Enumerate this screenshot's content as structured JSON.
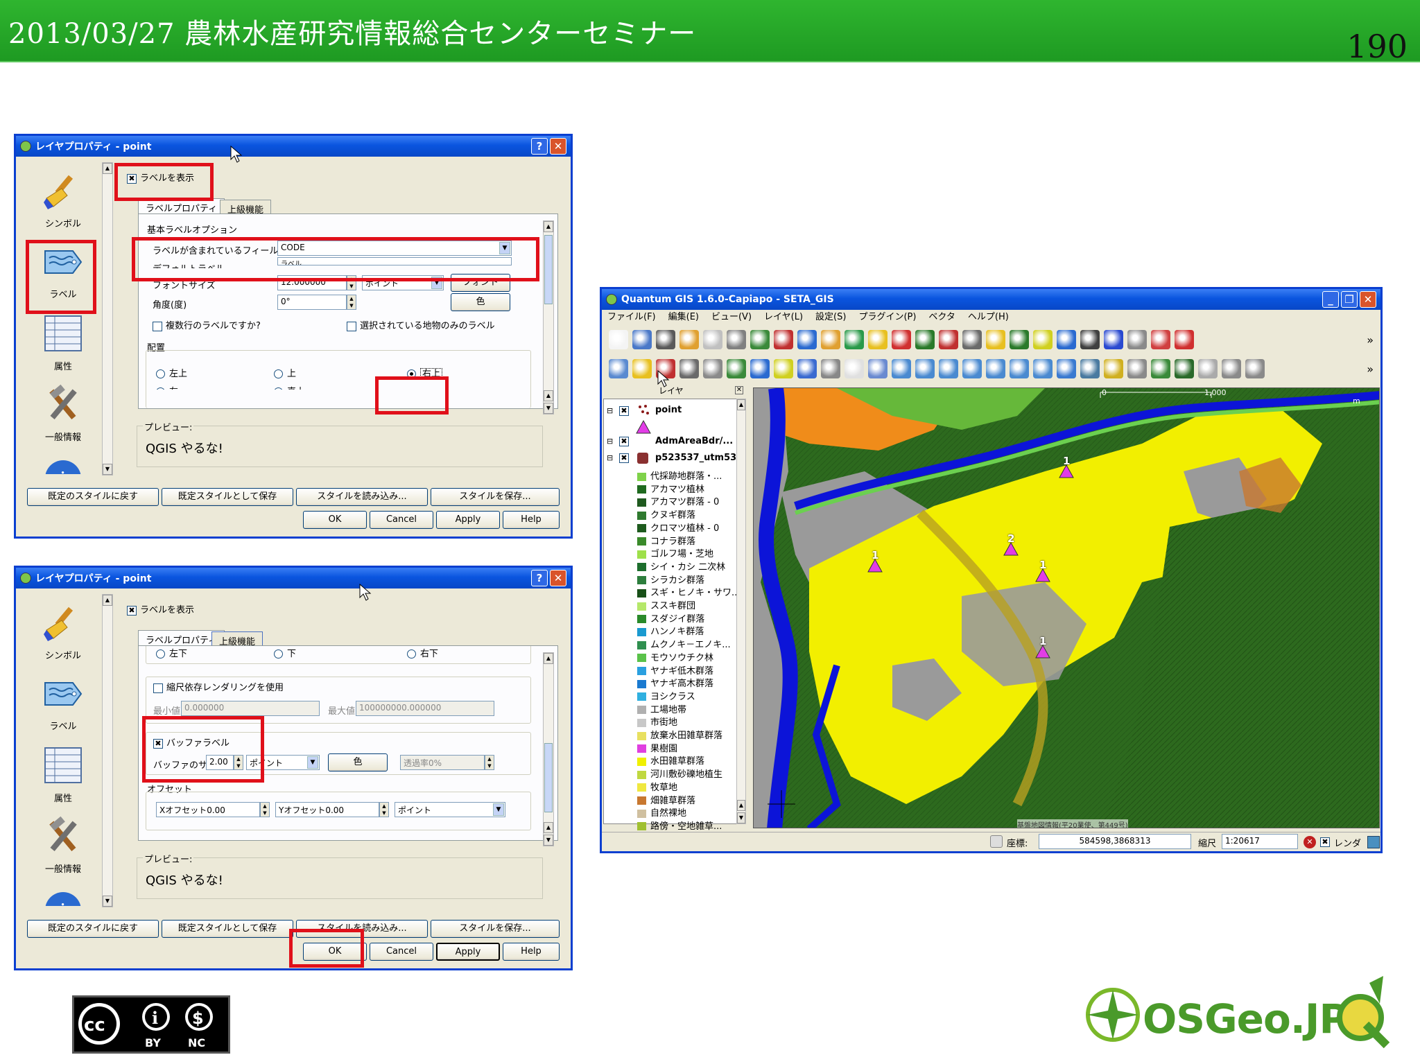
{
  "slide": {
    "title": "2013/03/27 農林水産研究情報総合センターセミナー",
    "page_number": "190",
    "license": {
      "by": "BY",
      "nc": "NC"
    },
    "logo_text": "OSGeo.JP"
  },
  "dialog1": {
    "title": "レイヤプロパティ - point",
    "sidebar": [
      "シンボル",
      "ラベル",
      "属性",
      "一般情報"
    ],
    "show_label": "ラベルを表示",
    "tabs": [
      "ラベルプロパティ",
      "上級機能"
    ],
    "basic_group": "基本ラベルオプション",
    "field_label": "ラベルが含まれているフィールド",
    "field_value": "CODE",
    "default_label": "デフォルトラベル",
    "default_label_value": "ラベル",
    "font_size_label": "フォントサイズ",
    "font_size_value": "12.000000",
    "unit": "ポイント",
    "font_button": "フォント",
    "angle_label": "角度(度)",
    "angle_value": "0°",
    "color_button": "色",
    "multiline": "複数行のラベルですか?",
    "selected_only": "選択されている地物のみのラベル",
    "placement_group": "配置",
    "placement": [
      "左上",
      "上",
      "右上"
    ],
    "placement_partial": [
      "左",
      "真上"
    ],
    "preview_title": "プレビュー:",
    "preview_text": "QGIS やるな!",
    "buttons_row1": [
      "既定のスタイルに戻す",
      "既定スタイルとして保存",
      "スタイルを読み込み...",
      "スタイルを保存..."
    ],
    "buttons_row2": [
      "OK",
      "Cancel",
      "Apply",
      "Help"
    ]
  },
  "dialog2": {
    "title": "レイヤプロパティ - point",
    "sidebar": [
      "シンボル",
      "ラベル",
      "属性",
      "一般情報"
    ],
    "show_label": "ラベルを表示",
    "tabs": [
      "ラベルプロパティ",
      "上級機能"
    ],
    "placement_bottom": [
      "左下",
      "下",
      "右下"
    ],
    "scale_render": "縮尺依存レンダリングを使用",
    "min_label": "最小値",
    "min_value": "0.000000",
    "max_label": "最大値",
    "max_value": "100000000.000000",
    "buffer_label": "バッファラベル",
    "buffer_size_label": "バッファのサイズ",
    "buffer_size_value": "2.00",
    "unit": "ポイント",
    "color_button": "色",
    "transparency": "透過率0%",
    "offset_group": "オフセット",
    "x_offset": "Xオフセット0.00",
    "y_offset": "Yオフセット0.00",
    "offset_unit": "ポイント",
    "preview_title": "プレビュー:",
    "preview_text": "QGIS やるな!",
    "buttons_row1": [
      "既定のスタイルに戻す",
      "既定スタイルとして保存",
      "スタイルを読み込み...",
      "スタイルを保存..."
    ],
    "buttons_row2": [
      "OK",
      "Cancel",
      "Apply",
      "Help"
    ]
  },
  "qgis": {
    "title": "Quantum GIS 1.6.0-Capiapo - SETA_GIS",
    "menu": [
      "ファイル(F)",
      "編集(E)",
      "ビュー(V)",
      "レイヤ(L)",
      "設定(S)",
      "プラグイン(P)",
      "ベクタ",
      "ヘルプ(H)"
    ],
    "legend_header": "レイヤ",
    "layers": [
      "point",
      "AdmAreaBdr/...",
      "p523537_utm53"
    ],
    "classes": [
      {
        "name": "代採跡地群落・...",
        "color": "#7fd24a"
      },
      {
        "name": "アカマツ植林",
        "color": "#1f6a1f"
      },
      {
        "name": "アカマツ群落 - 0",
        "color": "#1f5a1f"
      },
      {
        "name": "クヌギ群落",
        "color": "#2f7a2f"
      },
      {
        "name": "クロマツ植林 - 0",
        "color": "#1e5b1e"
      },
      {
        "name": "コナラ群落",
        "color": "#3a8a2a"
      },
      {
        "name": "ゴルフ場・芝地",
        "color": "#9ee04a"
      },
      {
        "name": "シイ・カシ 二次林",
        "color": "#1d6e2d"
      },
      {
        "name": "シラカシ群落",
        "color": "#2d7e3d"
      },
      {
        "name": "スギ・ヒノキ・サワ...",
        "color": "#185018"
      },
      {
        "name": "ススキ群団",
        "color": "#b5e86a"
      },
      {
        "name": "スダジイ群落",
        "color": "#2a8a2a"
      },
      {
        "name": "ハンノキ群落",
        "color": "#1a9ad0"
      },
      {
        "name": "ムクノキ－エノキ...",
        "color": "#2f8f4f"
      },
      {
        "name": "モウソウチク林",
        "color": "#5ac24a"
      },
      {
        "name": "ヤナギ低木群落",
        "color": "#2aa0e0"
      },
      {
        "name": "ヤナギ高木群落",
        "color": "#1a7ad0"
      },
      {
        "name": "ヨシクラス",
        "color": "#30b0e0"
      },
      {
        "name": "工場地帯",
        "color": "#b0b0b0"
      },
      {
        "name": "市街地",
        "color": "#c8c8c8"
      },
      {
        "name": "放棄水田雑草群落",
        "color": "#e8e060"
      },
      {
        "name": "果樹園",
        "color": "#e040e0"
      },
      {
        "name": "水田雑草群落",
        "color": "#f0f000"
      },
      {
        "name": "河川敷砂礫地植生",
        "color": "#c0d840"
      },
      {
        "name": "牧草地",
        "color": "#f0e840"
      },
      {
        "name": "畑雑草群落",
        "color": "#c87830"
      },
      {
        "name": "自然裸地",
        "color": "#d0c0a0"
      },
      {
        "name": "路傍・空地雑草...",
        "color": "#a0c030"
      }
    ],
    "scale_bar": [
      "0",
      "1,000"
    ],
    "scale_unit": "m",
    "point_labels": [
      "1",
      "2",
      "1",
      "1",
      "1"
    ],
    "attribution": "基盤地図情報(平20業使、第449号)",
    "status": {
      "coord_label": "座標:",
      "coord_value": "584598,3868313",
      "scale_label": "縮尺",
      "scale_value": "1:20617",
      "render": "レンダ"
    }
  },
  "colors": {
    "header_green": "#1e9a22",
    "xp_blue": "#0a55df",
    "highlight_red": "#e0101a"
  }
}
